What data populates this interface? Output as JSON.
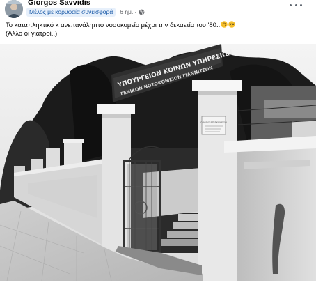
{
  "post": {
    "author": "Giorgos Savvidis",
    "badge": "Μέλος με κορυφαία συνεισφορά",
    "time": "6 ημ.",
    "separator": "·",
    "audience_icon": "globe-icon",
    "menu_icon": "more-options-icon",
    "caption_line1": "Το καταπληκτικό κ ανεπανάληπτο νοσοκομείο μέχρι την δεκαετία του '80..",
    "caption_line2": "(Άλλο οι γιατροί..)",
    "caption_emojis": [
      "upside-down-face-icon",
      "sunglasses-face-icon"
    ]
  },
  "photo": {
    "sign_line1": "ΥΠΟΥΡΓΕΙΟΝ ΚΟΙΝΩΝ ΥΠΗΡΕΣΙΩΝ",
    "sign_line2": "ΓΕΝΙΚΟΝ ΝΟΣΟΚΟΜΕΙΟΝ ΓΙΑΝΝΙΤΣΩΝ",
    "plaque_text": "ΩΡΑΡΙΟ ΕΠΙΣΚΕΨΕΩΝ",
    "tone": "black-and-white"
  },
  "colors": {
    "badge_bg": "#e7f0fb",
    "badge_text": "#1a5aa8",
    "meta_text": "#65676b"
  }
}
